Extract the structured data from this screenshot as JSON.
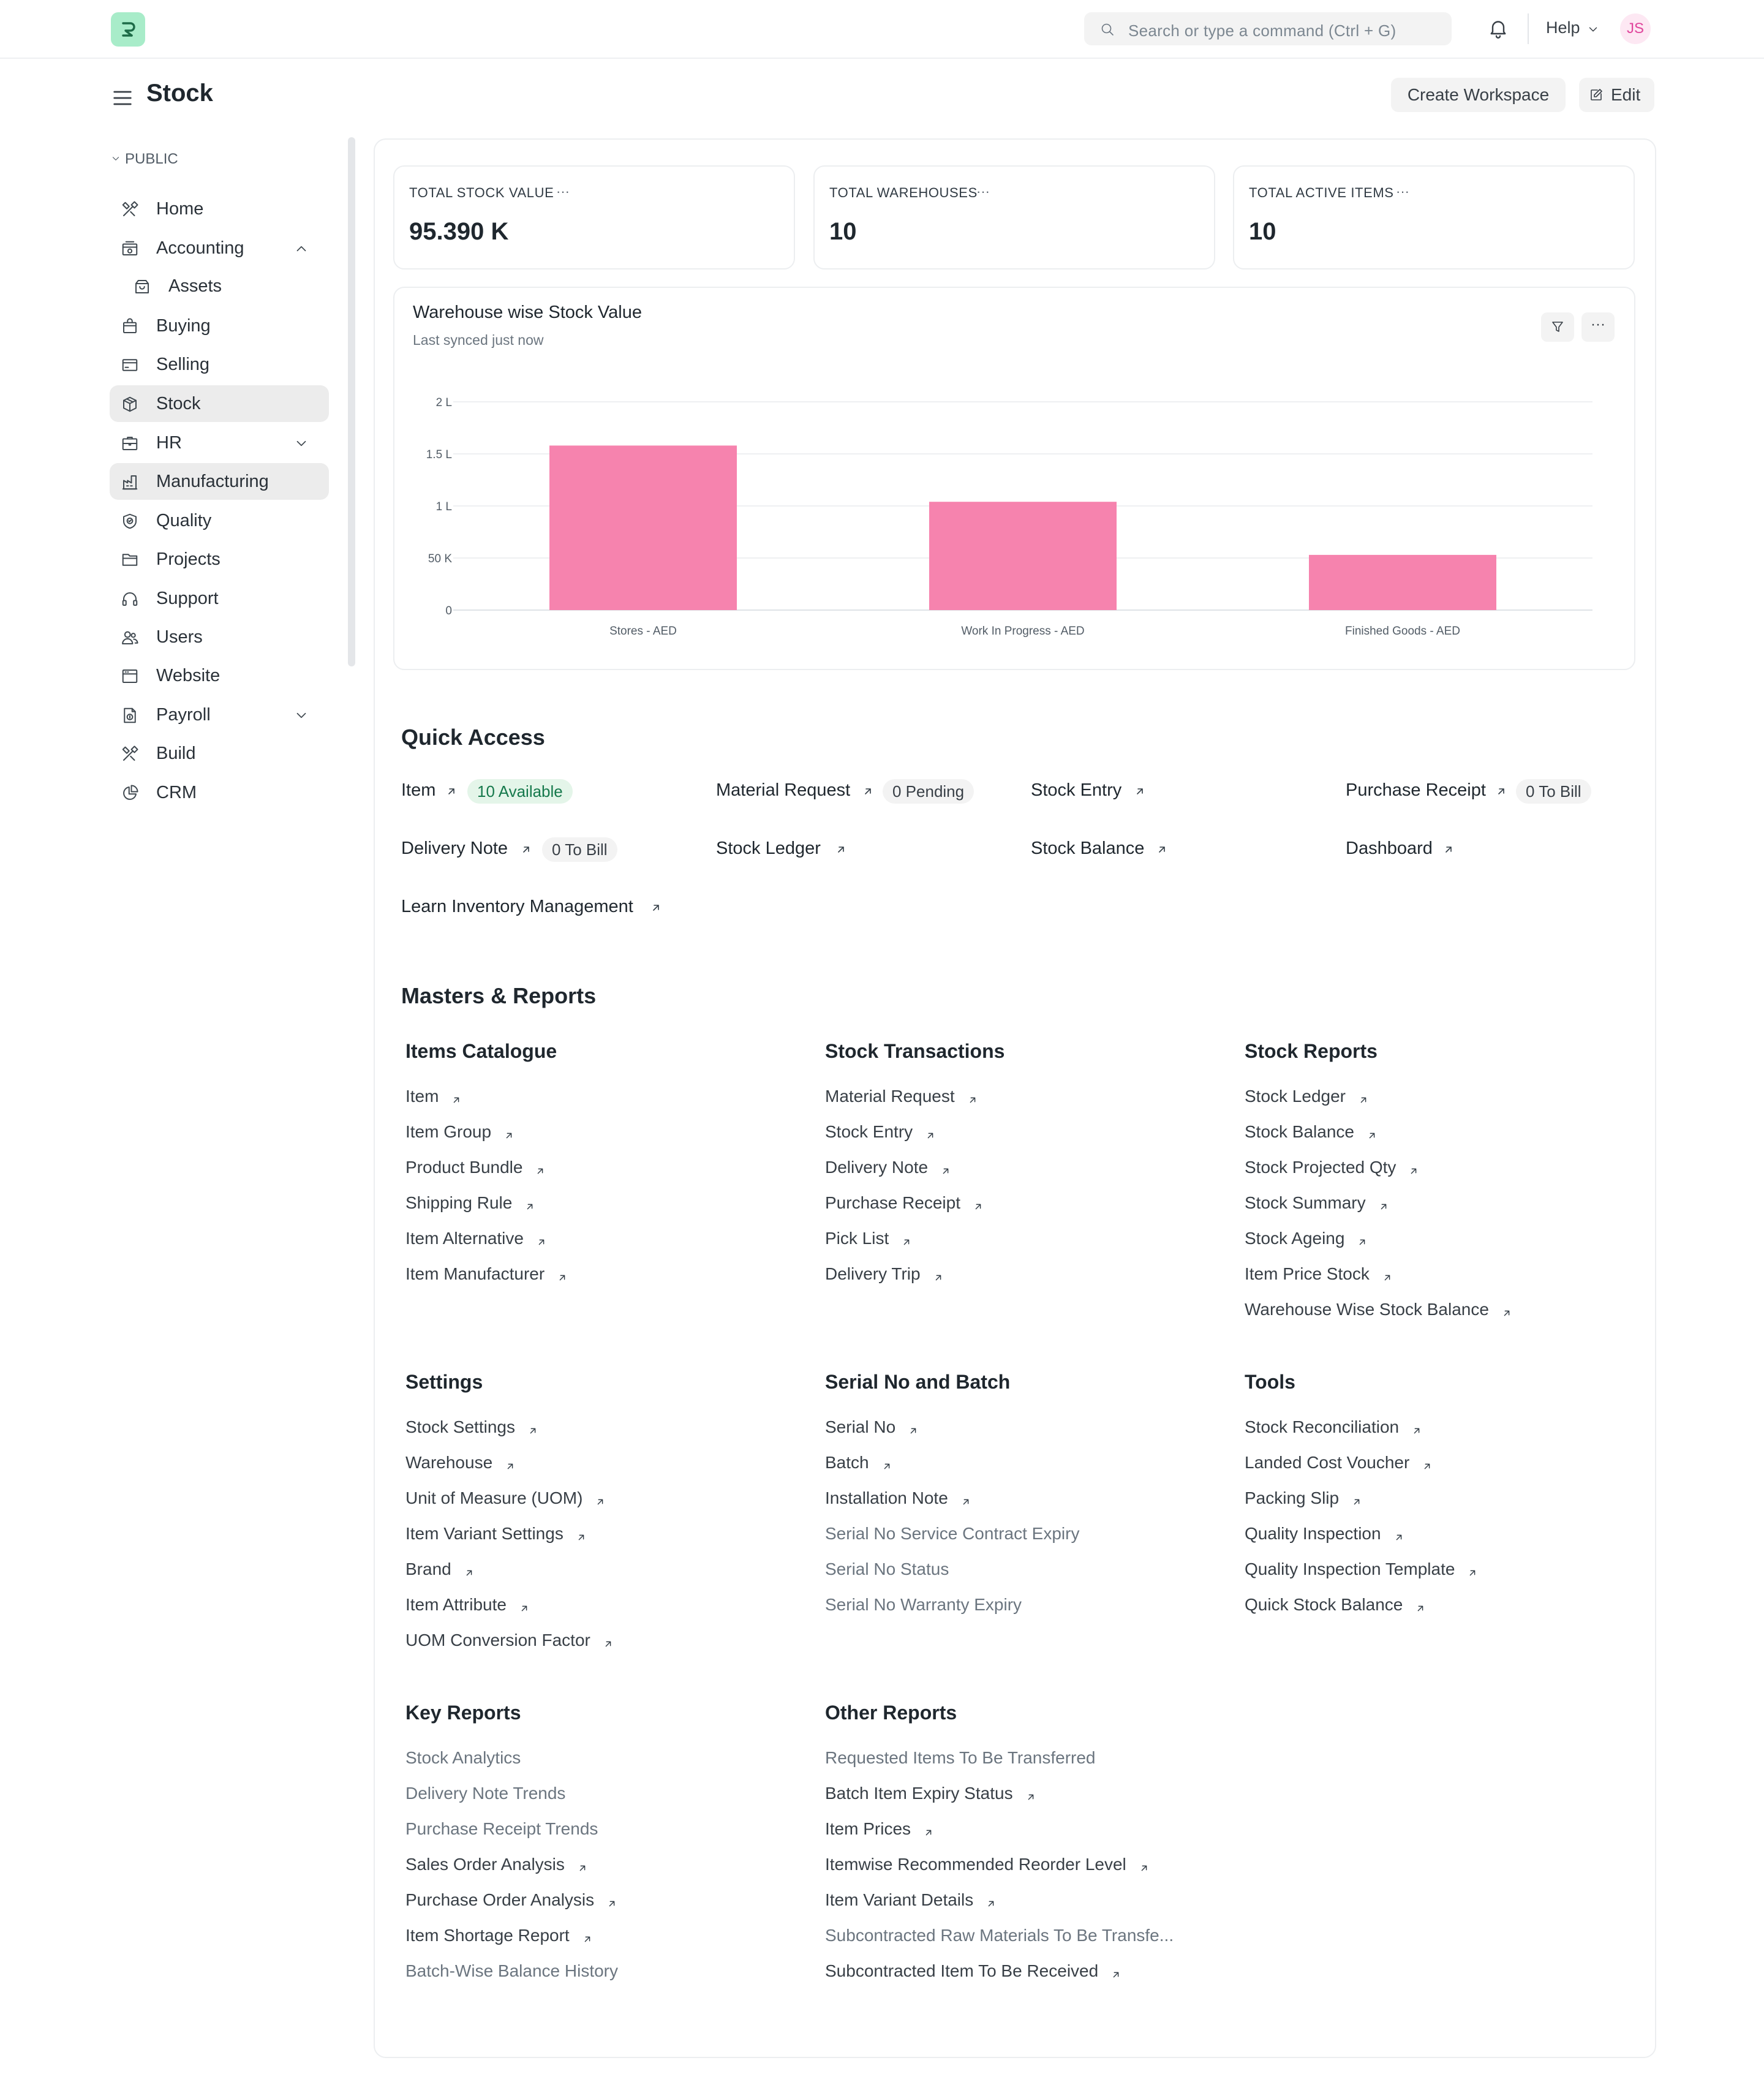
{
  "navbar": {
    "search_placeholder": "Search or type a command (Ctrl + G)",
    "help_label": "Help",
    "avatar_initials": "JS"
  },
  "header": {
    "title": "Stock",
    "create_workspace_label": "Create Workspace",
    "edit_label": "Edit"
  },
  "sidebar": {
    "section_label": "PUBLIC",
    "items": [
      {
        "label": "Home",
        "icon": "tools-icon"
      },
      {
        "label": "Accounting",
        "icon": "accounting-icon",
        "expanded": true
      },
      {
        "label": "Assets",
        "icon": "assets-icon"
      },
      {
        "label": "Buying",
        "icon": "buying-icon"
      },
      {
        "label": "Selling",
        "icon": "selling-icon"
      },
      {
        "label": "Stock",
        "icon": "stock-box-icon",
        "active": true
      },
      {
        "label": "HR",
        "icon": "hr-icon"
      },
      {
        "label": "Manufacturing",
        "icon": "manufacturing-icon",
        "hovered": true
      },
      {
        "label": "Quality",
        "icon": "quality-icon"
      },
      {
        "label": "Projects",
        "icon": "projects-folder-icon"
      },
      {
        "label": "Support",
        "icon": "support-headset-icon"
      },
      {
        "label": "Users",
        "icon": "users-icon"
      },
      {
        "label": "Website",
        "icon": "website-icon"
      },
      {
        "label": "Payroll",
        "icon": "payroll-icon"
      },
      {
        "label": "Build",
        "icon": "build-tools-icon"
      },
      {
        "label": "CRM",
        "icon": "crm-icon"
      }
    ]
  },
  "number_cards": [
    {
      "label": "TOTAL STOCK VALUE",
      "value": "95.390 K"
    },
    {
      "label": "TOTAL WAREHOUSES",
      "value": "10"
    },
    {
      "label": "TOTAL ACTIVE ITEMS",
      "value": "10"
    }
  ],
  "chart_card": {
    "title": "Warehouse wise Stock Value",
    "subtitle": "Last synced just now"
  },
  "chart_data": {
    "type": "bar",
    "categories": [
      "Stores - AED",
      "Work In Progress - AED",
      "Finished Goods - AED"
    ],
    "values": [
      158000,
      104000,
      53000
    ],
    "ytick_labels": [
      "0",
      "50 K",
      "1 L",
      "1.5 L",
      "2 L"
    ],
    "ytick_values": [
      0,
      50000,
      100000,
      150000,
      200000
    ],
    "ylim": [
      0,
      200000
    ],
    "grid": true,
    "legend": "none",
    "bar_color": "#f683ae"
  },
  "quick_access": {
    "title": "Quick Access",
    "items": [
      {
        "label": "Item",
        "pill": "10 Available",
        "pill_style": "green"
      },
      {
        "label": "Material Request",
        "pill": "0 Pending",
        "pill_style": "gray"
      },
      {
        "label": "Stock Entry",
        "pill": "",
        "pill_style": ""
      },
      {
        "label": "Purchase Receipt",
        "pill": "0 To Bill",
        "pill_style": "gray"
      },
      {
        "label": "Delivery Note",
        "pill": "0 To Bill",
        "pill_style": "gray"
      },
      {
        "label": "Stock Ledger",
        "pill": "",
        "pill_style": ""
      },
      {
        "label": "Stock Balance",
        "pill": "",
        "pill_style": ""
      },
      {
        "label": "Dashboard",
        "pill": "",
        "pill_style": ""
      },
      {
        "label": "Learn Inventory Management",
        "pill": "",
        "pill_style": ""
      }
    ]
  },
  "masters_reports": {
    "title": "Masters & Reports",
    "cards": [
      {
        "title": "Items Catalogue",
        "links": [
          {
            "label": "Item",
            "arrow": true
          },
          {
            "label": "Item Group",
            "arrow": true
          },
          {
            "label": "Product Bundle",
            "arrow": true
          },
          {
            "label": "Shipping Rule",
            "arrow": true
          },
          {
            "label": "Item Alternative",
            "arrow": true
          },
          {
            "label": "Item Manufacturer",
            "arrow": true
          }
        ]
      },
      {
        "title": "Stock Transactions",
        "links": [
          {
            "label": "Material Request",
            "arrow": true
          },
          {
            "label": "Stock Entry",
            "arrow": true
          },
          {
            "label": "Delivery Note",
            "arrow": true
          },
          {
            "label": "Purchase Receipt",
            "arrow": true
          },
          {
            "label": "Pick List",
            "arrow": true
          },
          {
            "label": "Delivery Trip",
            "arrow": true
          }
        ]
      },
      {
        "title": "Stock Reports",
        "links": [
          {
            "label": "Stock Ledger",
            "arrow": true
          },
          {
            "label": "Stock Balance",
            "arrow": true
          },
          {
            "label": "Stock Projected Qty",
            "arrow": true
          },
          {
            "label": "Stock Summary",
            "arrow": true
          },
          {
            "label": "Stock Ageing",
            "arrow": true
          },
          {
            "label": "Item Price Stock",
            "arrow": true
          },
          {
            "label": "Warehouse Wise Stock Balance",
            "arrow": true
          }
        ]
      },
      {
        "title": "Settings",
        "links": [
          {
            "label": "Stock Settings",
            "arrow": true
          },
          {
            "label": "Warehouse",
            "arrow": true
          },
          {
            "label": "Unit of Measure (UOM)",
            "arrow": true
          },
          {
            "label": "Item Variant Settings",
            "arrow": true
          },
          {
            "label": "Brand",
            "arrow": true
          },
          {
            "label": "Item Attribute",
            "arrow": true
          },
          {
            "label": "UOM Conversion Factor",
            "arrow": true
          }
        ]
      },
      {
        "title": "Serial No and Batch",
        "links": [
          {
            "label": "Serial No",
            "arrow": true
          },
          {
            "label": "Batch",
            "arrow": true
          },
          {
            "label": "Installation Note",
            "arrow": true
          },
          {
            "label": "Serial No Service Contract Expiry",
            "arrow": false
          },
          {
            "label": "Serial No Status",
            "arrow": false
          },
          {
            "label": "Serial No Warranty Expiry",
            "arrow": false
          }
        ]
      },
      {
        "title": "Tools",
        "links": [
          {
            "label": "Stock Reconciliation",
            "arrow": true
          },
          {
            "label": "Landed Cost Voucher",
            "arrow": true
          },
          {
            "label": "Packing Slip",
            "arrow": true
          },
          {
            "label": "Quality Inspection",
            "arrow": true
          },
          {
            "label": "Quality Inspection Template",
            "arrow": true
          },
          {
            "label": "Quick Stock Balance",
            "arrow": true
          }
        ]
      },
      {
        "title": "Key Reports",
        "links": [
          {
            "label": "Stock Analytics",
            "arrow": false
          },
          {
            "label": "Delivery Note Trends",
            "arrow": false
          },
          {
            "label": "Purchase Receipt Trends",
            "arrow": false
          },
          {
            "label": "Sales Order Analysis",
            "arrow": true
          },
          {
            "label": "Purchase Order Analysis",
            "arrow": true
          },
          {
            "label": "Item Shortage Report",
            "arrow": true
          },
          {
            "label": "Batch-Wise Balance History",
            "arrow": false
          }
        ]
      },
      {
        "title": "Other Reports",
        "links": [
          {
            "label": "Requested Items To Be Transferred",
            "arrow": false
          },
          {
            "label": "Batch Item Expiry Status",
            "arrow": true
          },
          {
            "label": "Item Prices",
            "arrow": true
          },
          {
            "label": "Itemwise Recommended Reorder Level",
            "arrow": true
          },
          {
            "label": "Item Variant Details",
            "arrow": true
          },
          {
            "label": "Subcontracted Raw Materials To Be Transfe...",
            "arrow": false
          },
          {
            "label": "Subcontracted Item To Be Received",
            "arrow": true
          }
        ]
      }
    ]
  }
}
